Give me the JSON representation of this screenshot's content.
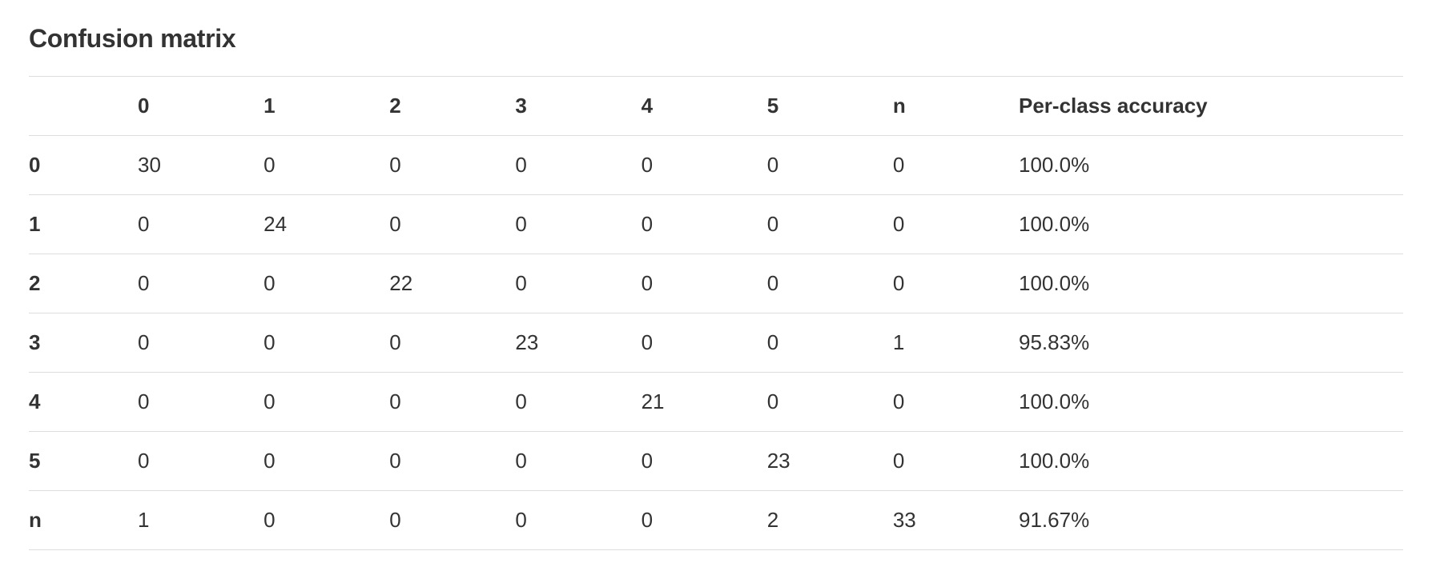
{
  "title": "Confusion matrix",
  "chart_data": {
    "type": "table",
    "columns": [
      "0",
      "1",
      "2",
      "3",
      "4",
      "5",
      "n",
      "Per-class accuracy"
    ],
    "row_labels": [
      "0",
      "1",
      "2",
      "3",
      "4",
      "5",
      "n"
    ],
    "rows": [
      [
        "30",
        "0",
        "0",
        "0",
        "0",
        "0",
        "0",
        "100.0%"
      ],
      [
        "0",
        "24",
        "0",
        "0",
        "0",
        "0",
        "0",
        "100.0%"
      ],
      [
        "0",
        "0",
        "22",
        "0",
        "0",
        "0",
        "0",
        "100.0%"
      ],
      [
        "0",
        "0",
        "0",
        "23",
        "0",
        "0",
        "1",
        "95.83%"
      ],
      [
        "0",
        "0",
        "0",
        "0",
        "21",
        "0",
        "0",
        "100.0%"
      ],
      [
        "0",
        "0",
        "0",
        "0",
        "0",
        "23",
        "0",
        "100.0%"
      ],
      [
        "1",
        "0",
        "0",
        "0",
        "0",
        "2",
        "33",
        "91.67%"
      ]
    ]
  }
}
